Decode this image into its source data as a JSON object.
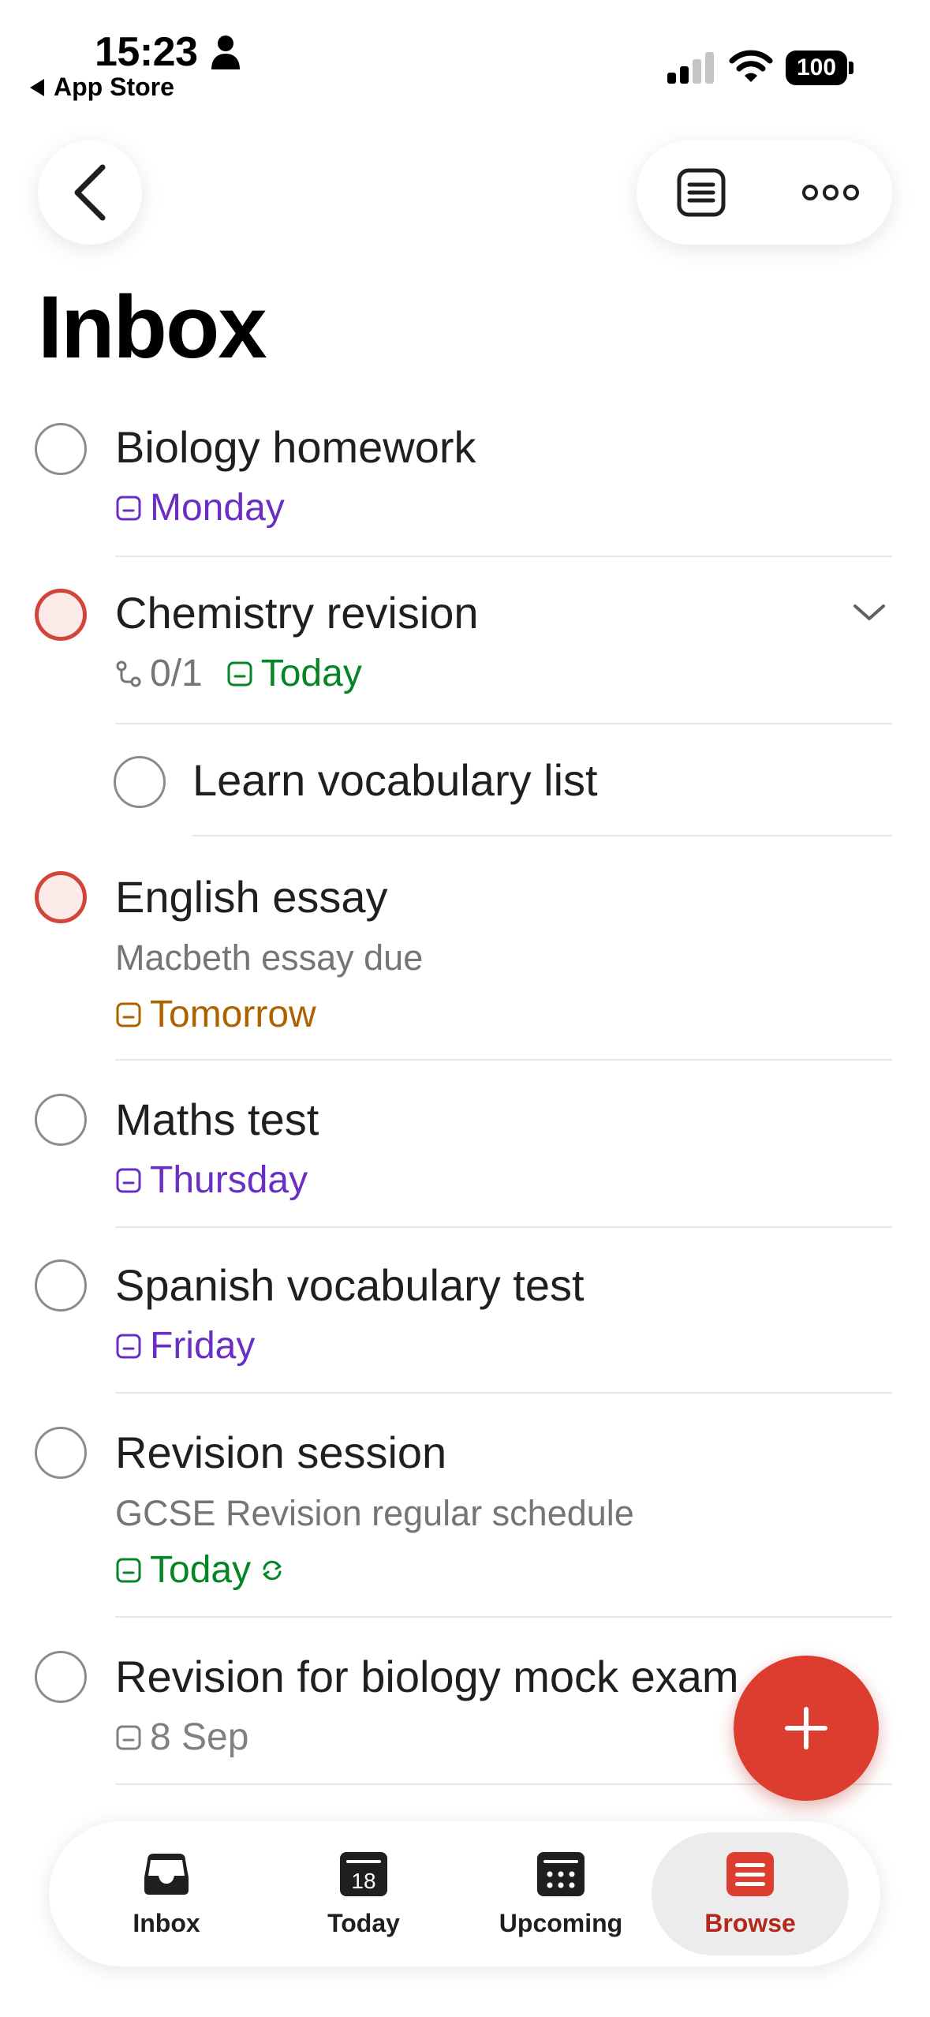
{
  "status_bar": {
    "time": "15:23",
    "back_app": "App Store",
    "battery": "100"
  },
  "page": {
    "title": "Inbox"
  },
  "tasks": [
    {
      "title": "Biology homework",
      "due": "Monday",
      "due_color": "#692ec2",
      "priority": "none"
    },
    {
      "title": "Chemistry revision",
      "subtasks": "0/1",
      "due": "Today",
      "due_color": "#058527",
      "priority": "p1",
      "expanded": true
    },
    {
      "title": "Learn vocabulary list",
      "subtask": true
    },
    {
      "title": "English essay",
      "description": "Macbeth essay due",
      "due": "Tomorrow",
      "due_color": "#ad6200",
      "priority": "p1"
    },
    {
      "title": "Maths test",
      "due": "Thursday",
      "due_color": "#692ec2"
    },
    {
      "title": "Spanish vocabulary test",
      "due": "Friday",
      "due_color": "#692ec2"
    },
    {
      "title": "Revision session",
      "description": "GCSE Revision regular schedule",
      "due": "Today",
      "due_color": "#058527",
      "recurring": true
    },
    {
      "title": "Revision for biology mock exam",
      "due": "8 Sep",
      "due_color": "#808080"
    }
  ],
  "tab_bar": {
    "inbox": "Inbox",
    "today": "Today",
    "today_day": "18",
    "upcoming": "Upcoming",
    "browse": "Browse",
    "active": "Browse",
    "accent": "#b5271d"
  },
  "fab": {
    "accent": "#dc3d2f"
  }
}
